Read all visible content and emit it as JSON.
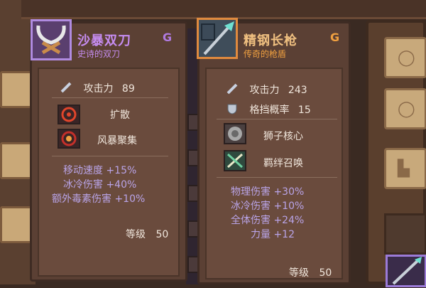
{
  "card_left": {
    "name": "沙暴双刀",
    "grade": "G",
    "subtitle": "史诗的双刀",
    "attack_label": "攻击力",
    "attack_value": "89",
    "skills": [
      "扩散",
      "风暴聚集"
    ],
    "stats": [
      "移动速度 +15%",
      "冰冷伤害 +40%",
      "额外毒素伤害 +10%"
    ],
    "level_label": "等级",
    "level_value": "50"
  },
  "card_right": {
    "name": "精钢长枪",
    "grade": "G",
    "subtitle": "传奇的枪盾",
    "attack_label": "攻击力",
    "attack_value": "243",
    "block_label": "格挡概率",
    "block_value": "15",
    "skills": [
      "狮子核心",
      "羁绊召唤"
    ],
    "stats": [
      "物理伤害 +30%",
      "冰冷伤害 +10%",
      "全体伤害 +24%",
      "力量 +12"
    ],
    "level_label": "等级",
    "level_value": "50"
  },
  "colors": {
    "epic": "#c58cf0",
    "legendary": "#f0a040",
    "stat_text": "#b9a4e8",
    "grade_epic": "#b07ae0",
    "grade_legendary": "#f0a040"
  },
  "icons": {
    "left_portrait": "crossed-blades-icon",
    "right_portrait": "spear-icon",
    "attack": "sword-icon",
    "block": "shield-icon",
    "skill_left_1": "burst-ring-icon",
    "skill_left_2": "storm-ring-icon",
    "skill_right_1": "lion-core-icon",
    "skill_right_2": "bond-summon-icon"
  }
}
